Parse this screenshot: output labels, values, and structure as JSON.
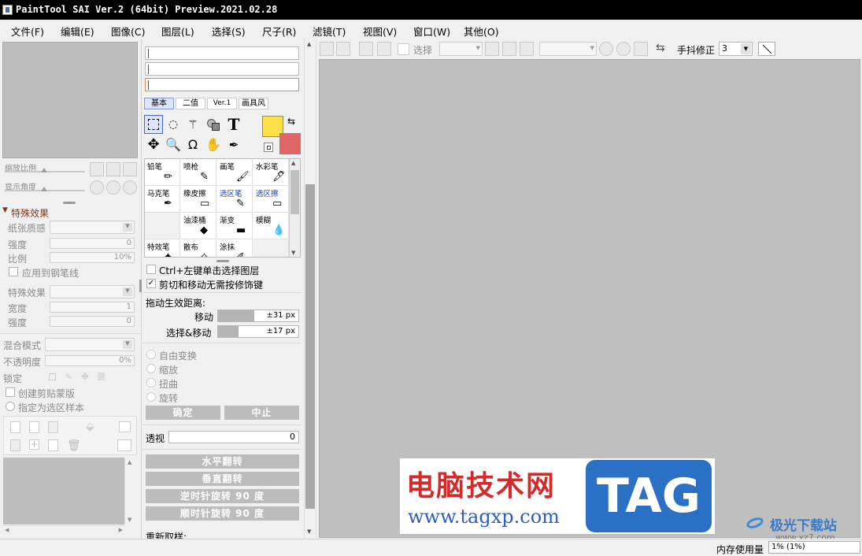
{
  "title": "PaintTool SAI Ver.2 (64bit) Preview.2021.02.28",
  "menu": [
    "文件(F)",
    "编辑(E)",
    "图像(C)",
    "图层(L)",
    "选择(S)",
    "尺子(R)",
    "滤镜(T)",
    "视图(V)",
    "窗口(W)",
    "其他(O)"
  ],
  "left": {
    "zoom_label": "缩放比例",
    "angle_label": "显示角度",
    "effects_title": "特殊效果",
    "paper_texture": "纸张质感",
    "strength": "强度",
    "ratio": "比例",
    "strength_value": "0",
    "ratio_value": "10%",
    "apply_pencil": "应用到钢笔线",
    "special_effect": "特殊效果",
    "width": "宽度",
    "strength2": "强度",
    "width_value": "1",
    "strength2_value": "0",
    "blend_mode": "混合模式",
    "opacity": "不透明度",
    "opacity_value": "0%",
    "lock": "锁定",
    "clip_mask": "创建剪贴蒙版",
    "selection_sample": "指定为选区样本"
  },
  "tools": {
    "tabs": [
      "基本",
      "二值",
      "Ver.1",
      "画具风"
    ],
    "brushes": [
      {
        "name": "铅笔",
        "color": "#000000"
      },
      {
        "name": "喷枪",
        "color": "#000000"
      },
      {
        "name": "画笔",
        "color": "#000000"
      },
      {
        "name": "水彩笔",
        "color": "#000000"
      },
      {
        "name": "马克笔",
        "color": "#000000"
      },
      {
        "name": "橡皮擦",
        "color": "#000000"
      },
      {
        "name": "选区笔",
        "color": "#1a3ccc"
      },
      {
        "name": "选区擦",
        "color": "#1a3ccc"
      },
      {
        "name": "",
        "color": "#000000"
      },
      {
        "name": "油漆桶",
        "color": "#000000"
      },
      {
        "name": "渐变",
        "color": "#000000"
      },
      {
        "name": "模糊",
        "color": "#000000"
      },
      {
        "name": "特效笔",
        "color": "#000000"
      },
      {
        "name": "散布",
        "color": "#000000"
      },
      {
        "name": "涂抹",
        "color": "#000000"
      },
      {
        "name": "",
        "color": "#000000"
      }
    ],
    "primary_color": "#fde14a",
    "secondary_color": "#e06565"
  },
  "options": {
    "ctrl_click": "Ctrl+左键单击选择图层",
    "cut_move": "剪切和移动无需按修饰键",
    "drag_distance": "拖动生效距离:",
    "move": "移动",
    "move_value": "±31 px",
    "move_fill": 0.45,
    "select_move": "选择&移动",
    "select_move_value": "±17 px",
    "select_move_fill": 0.25,
    "free_transform": "自由变换",
    "scale": "缩放",
    "distort": "扭曲",
    "rotate": "旋转",
    "ok": "确定",
    "cancel": "中止",
    "perspective": "透视",
    "perspective_value": "0",
    "flip_h": "水平翻转",
    "flip_v": "垂直翻转",
    "rotate_ccw": "逆时针旋转 90 度",
    "rotate_cw": "顺时针旋转 90 度",
    "resample": "重新取样:"
  },
  "toolbar": {
    "select_label": "选择",
    "stabilizer_label": "手抖修正",
    "stabilizer_value": "3"
  },
  "status": {
    "memory_label": "内存使用量",
    "memory_value": "1% (1%)"
  },
  "watermark": {
    "line1": "电脑技术网",
    "line2": "www.tagxp.com",
    "tag": "TAG",
    "site": "极光下载站",
    "site_url": "www.xz7.com"
  }
}
